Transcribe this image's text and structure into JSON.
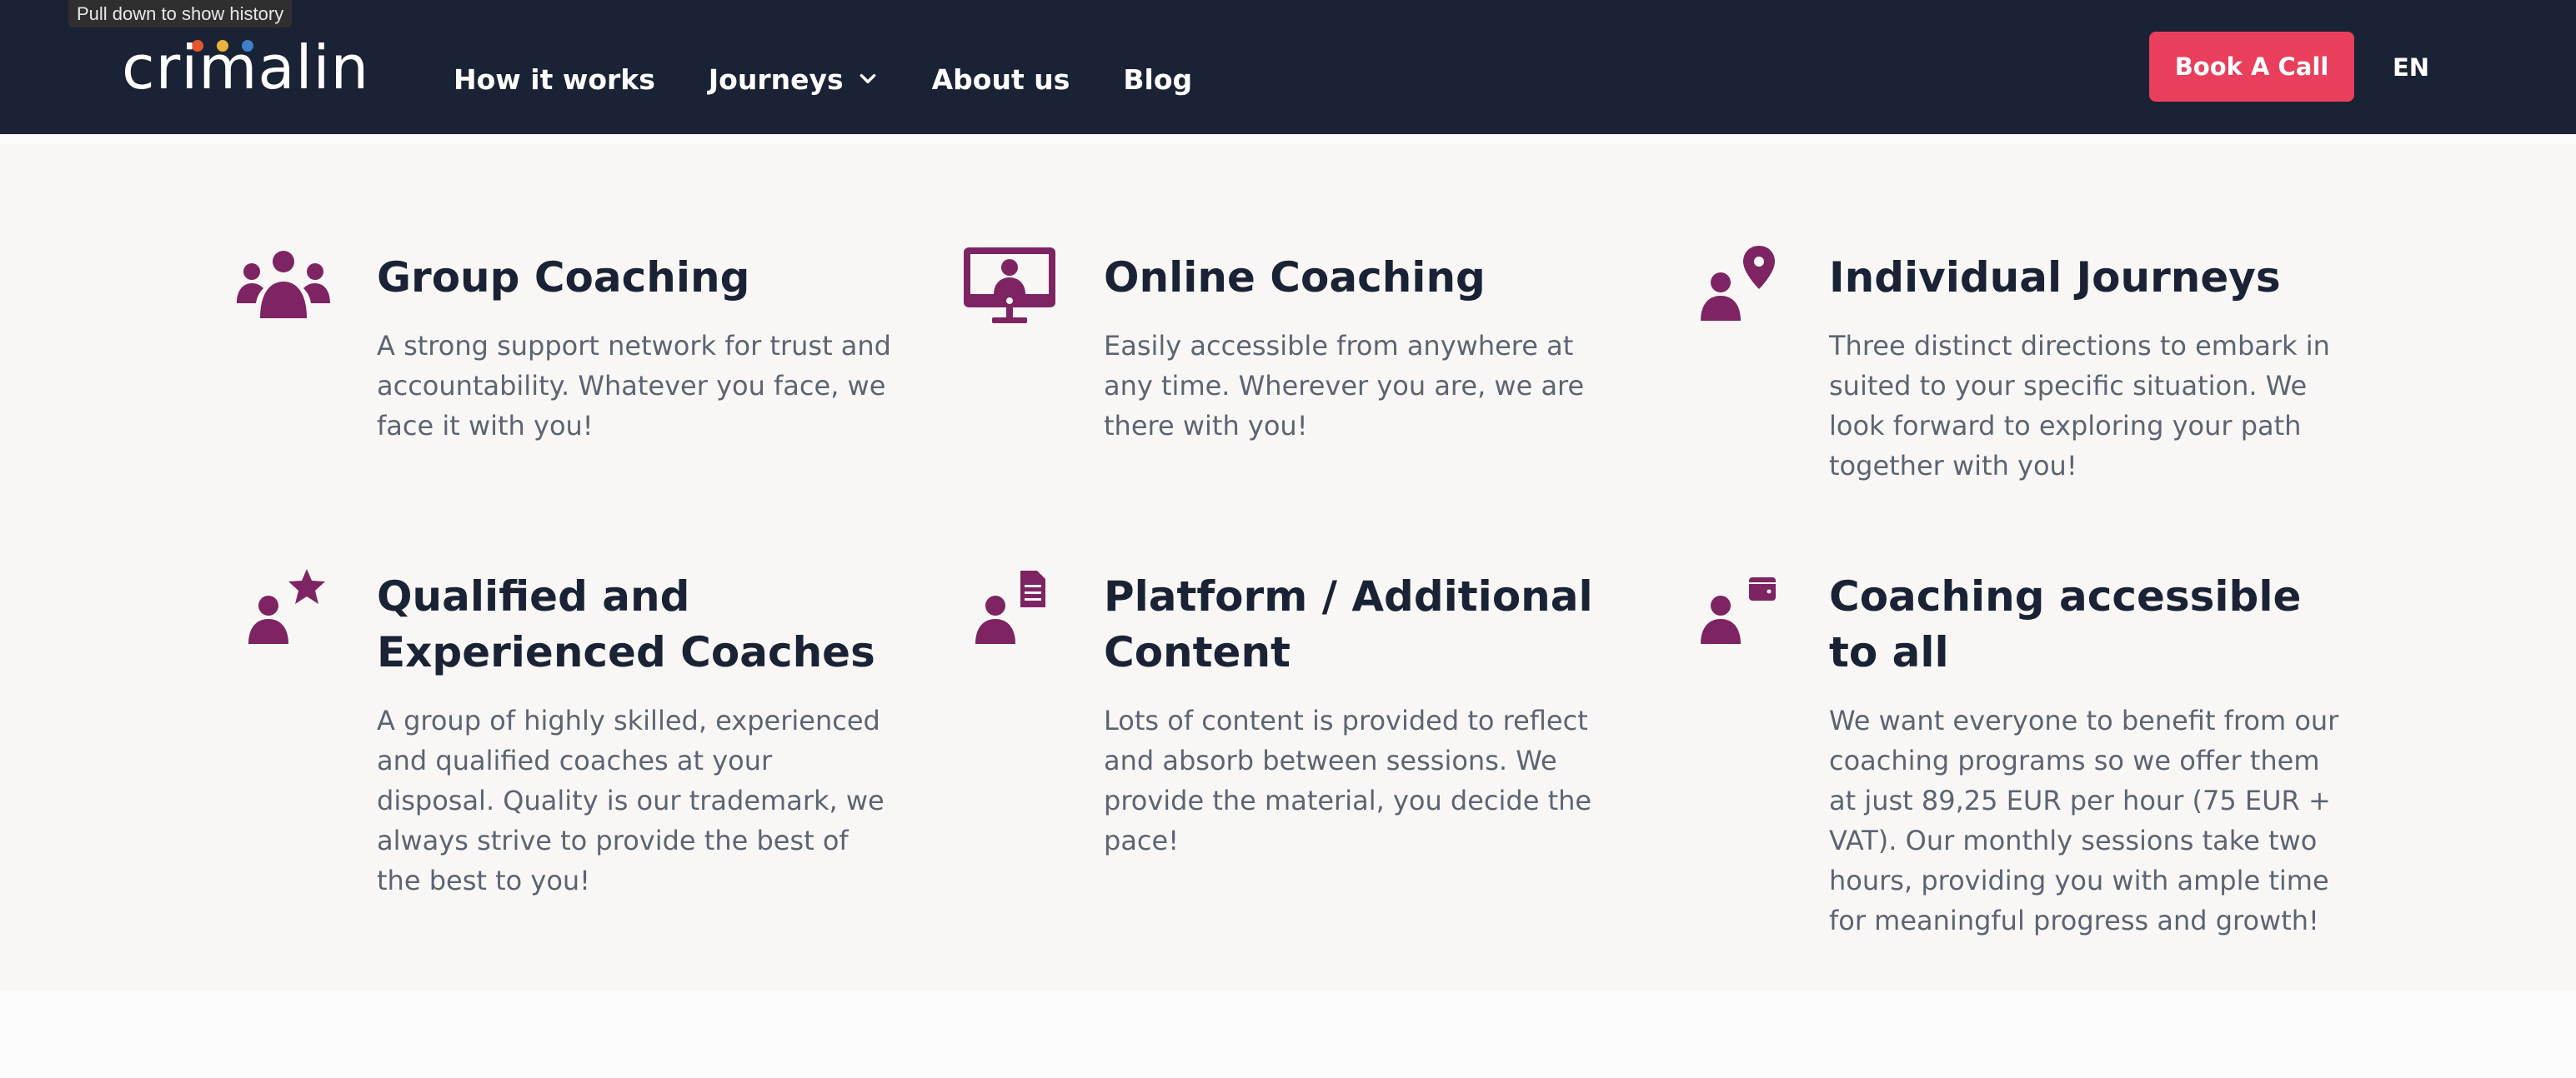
{
  "browser": {
    "tooltip": "Pull down to show history"
  },
  "header": {
    "logo_text": "crimalin",
    "nav": [
      {
        "label": "How it works"
      },
      {
        "label": "Journeys",
        "has_dropdown": true
      },
      {
        "label": "About us"
      },
      {
        "label": "Blog"
      }
    ],
    "cta_label": "Book A Call",
    "language": "EN"
  },
  "colors": {
    "header_bg": "#1a2335",
    "cta": "#ea3f5c",
    "icon": "#7e2462",
    "section_bg": "#f9f7f6",
    "heading": "#1a2335",
    "body_text": "#5c6472",
    "logo_dots": [
      "#e4572e",
      "#e8b53a",
      "#3d7fc8"
    ]
  },
  "features": [
    {
      "icon": "group-icon",
      "title": "Group Coaching",
      "text": "A strong support network for trust and accountability. Whatever you face, we face it with you!"
    },
    {
      "icon": "monitor-person-icon",
      "title": "Online Coaching",
      "text": "Easily accessible from anywhere at any time. Wherever you are, we are there with you!"
    },
    {
      "icon": "person-location-icon",
      "title": "Individual Journeys",
      "text": "Three distinct directions to embark in suited to your specific situation. We look forward to exploring your path together with you!"
    },
    {
      "icon": "person-star-icon",
      "title": "Qualified and Experienced Coaches",
      "text": "A group of highly skilled, experienced and qualified coaches at your disposal. Quality is our trademark, we always strive to provide the best of the best to you!"
    },
    {
      "icon": "person-document-icon",
      "title": "Platform / Additional Content",
      "text": "Lots of content is provided to reflect and absorb between sessions. We provide the material, you decide the pace!"
    },
    {
      "icon": "person-wallet-icon",
      "title": "Coaching accessible to all",
      "text": "We want everyone to benefit from our coaching programs so we offer them at just 89,25 EUR per hour (75 EUR + VAT). Our monthly sessions take two hours, providing you with ample time for meaningful progress and growth!"
    }
  ]
}
